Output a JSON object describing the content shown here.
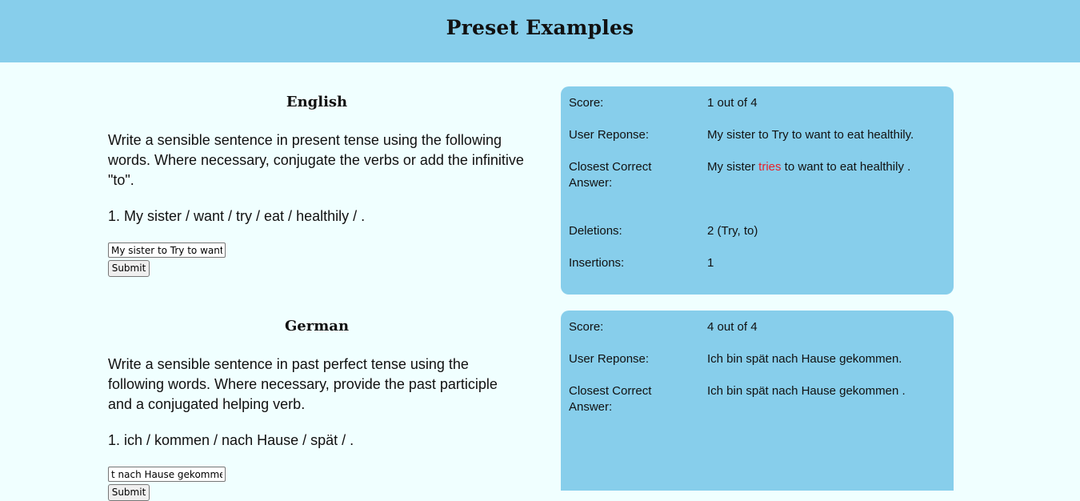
{
  "page": {
    "title": "Preset Examples"
  },
  "colors": {
    "header_bg": "#87ceeb",
    "page_bg": "#f0ffff",
    "result_bg": "#87ceeb",
    "highlight": "#e8202a"
  },
  "english": {
    "title": "English",
    "instructions": "Write a sensible sentence in present tense using the following words. Where necessary, conjugate the verbs or add the infinitive \"to\".",
    "prompt": "1. My sister / want / try / eat / healthily / .",
    "input_value": "My sister to Try to want to eat healthily.",
    "submit_label": "Submit",
    "result": {
      "score_label": "Score:",
      "score_value": "1 out of 4",
      "response_label": "User Reponse:",
      "response_value": "My sister to Try to want to eat healthily.",
      "closest_label": "Closest Correct Answer:",
      "closest_before": "My sister ",
      "closest_highlight": "tries",
      "closest_after": " to want to eat healthily .",
      "deletions_label": "Deletions:",
      "deletions_value": "2 (Try, to)",
      "insertions_label": "Insertions:",
      "insertions_value": "1"
    }
  },
  "german": {
    "title": "German",
    "instructions": "Write a sensible sentence in past perfect tense using the following words. Where necessary, provide the past participle and a conjugated helping verb.",
    "prompt": "1. ich / kommen / nach Hause / spät / .",
    "input_value": "t nach Hause gekommen",
    "submit_label": "Submit",
    "result": {
      "score_label": "Score:",
      "score_value": "4 out of 4",
      "response_label": "User Reponse:",
      "response_value": "Ich bin spät nach Hause gekommen.",
      "closest_label": "Closest Correct Answer:",
      "closest_value": "Ich bin spät nach Hause gekommen ."
    }
  }
}
